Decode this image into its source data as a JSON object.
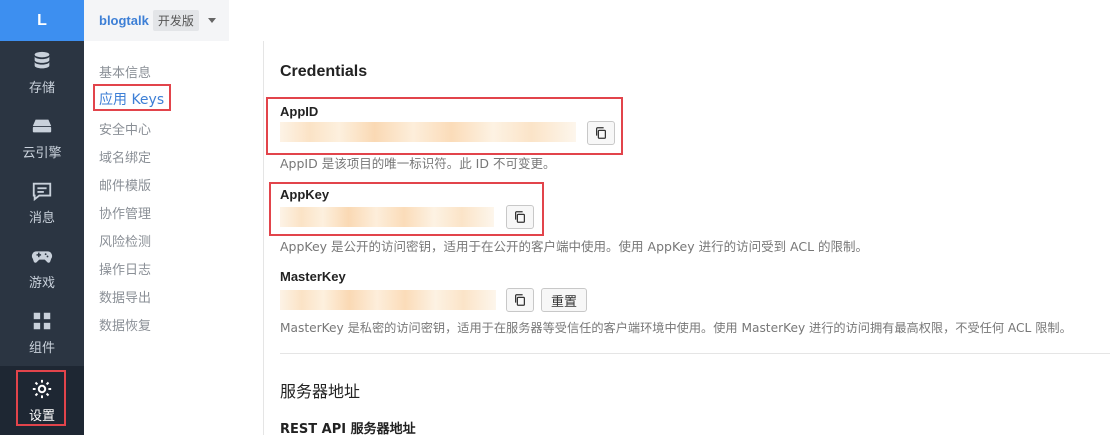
{
  "rail": {
    "brand": "L",
    "items": [
      {
        "label": "存储",
        "icon": "database-icon"
      },
      {
        "label": "云引擎",
        "icon": "server-icon"
      },
      {
        "label": "消息",
        "icon": "message-icon"
      },
      {
        "label": "游戏",
        "icon": "gamepad-icon"
      },
      {
        "label": "组件",
        "icon": "puzzle-icon"
      },
      {
        "label": "设置",
        "icon": "gear-icon"
      }
    ]
  },
  "topbar": {
    "app_name": "blogtalk",
    "edition": "开发版"
  },
  "subnav": {
    "items": [
      "基本信息",
      "应用 Keys",
      "安全中心",
      "域名绑定",
      "邮件模版",
      "协作管理",
      "风险检测",
      "操作日志",
      "数据导出",
      "数据恢复"
    ]
  },
  "credentials": {
    "heading": "Credentials",
    "appid": {
      "label": "AppID",
      "help": "AppID 是该项目的唯一标识符。此 ID 不可变更。"
    },
    "appkey": {
      "label": "AppKey",
      "help": "AppKey 是公开的访问密钥，适用于在公开的客户端中使用。使用 AppKey 进行的访问受到 ACL 的限制。"
    },
    "masterkey": {
      "label": "MasterKey",
      "reset": "重置",
      "help": "MasterKey 是私密的访问密钥，适用于在服务器等受信任的客户端环境中使用。使用 MasterKey 进行的访问拥有最高权限，不受任何 ACL 限制。"
    }
  },
  "server": {
    "heading": "服务器地址",
    "rest_label": "REST API 服务器地址"
  },
  "colors": {
    "accent": "#3d7fd6",
    "rail_bg": "#2b3542",
    "highlight": "#e2444b"
  }
}
